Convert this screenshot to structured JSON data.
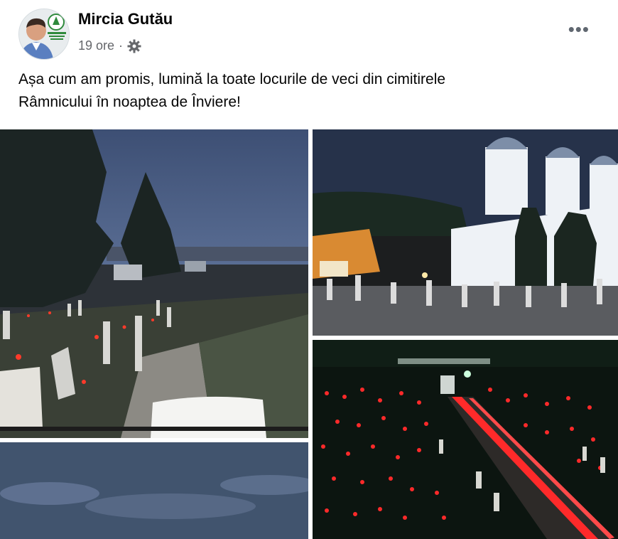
{
  "post": {
    "author": "Mircia Gutău",
    "time": "19 ore",
    "separator": "·",
    "more_label": "•••",
    "text_line1": "Așa cum am promis, lumină  la toate locurile de veci din cimitirele",
    "text_line2": "Râmnicului în noaptea de Înviere!"
  },
  "icons": {
    "avatar": "profile-photo",
    "audience": "gear-icon",
    "more": "more-options-icon"
  },
  "colors": {
    "text": "#050505",
    "secondary": "#65676b",
    "candle_red": "#ff2a2a"
  }
}
